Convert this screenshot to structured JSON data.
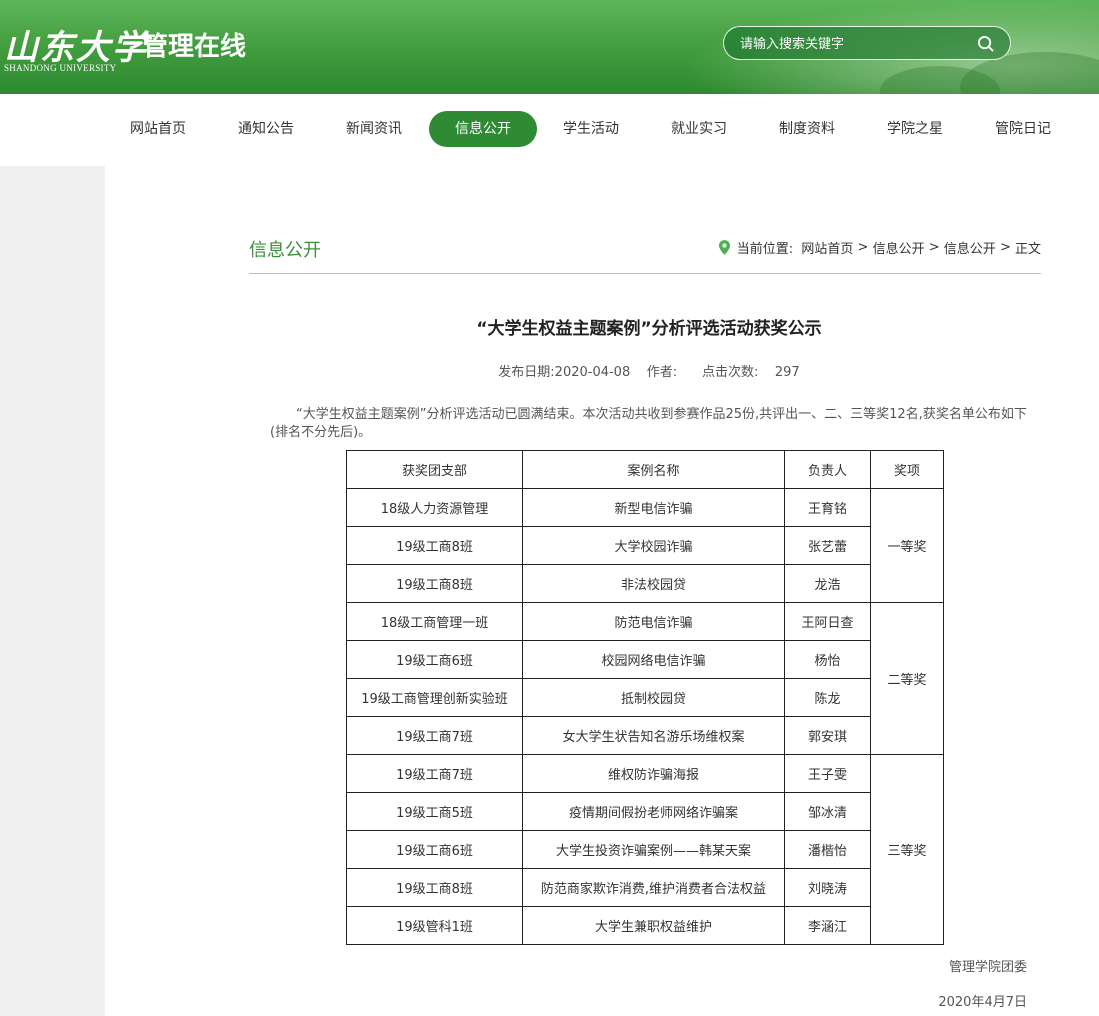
{
  "header": {
    "logo_cn": "山东大学",
    "logo_en": "SHANDONG UNIVERSITY",
    "site_title": "管理在线",
    "search_placeholder": "请输入搜索关键字",
    "search_icon": "search-icon"
  },
  "nav": {
    "items": [
      "网站首页",
      "通知公告",
      "新闻资讯",
      "信息公开",
      "学生活动",
      "就业实习",
      "制度资料",
      "学院之星",
      "管院日记"
    ],
    "active": "信息公开"
  },
  "section": {
    "title": "信息公开",
    "breadcrumb_label": "当前位置:",
    "breadcrumb": [
      "网站首页",
      "信息公开",
      "信息公开",
      "正文"
    ],
    "separator": ">"
  },
  "article": {
    "title": "“大学生权益主题案例”分析评选活动获奖公示",
    "publish_label": "发布日期:",
    "publish_date": "2020-04-08",
    "author_label": "作者:",
    "views_label": "点击次数:",
    "views": "297",
    "intro": "“大学生权益主题案例”分析评选活动已圆满结束。本次活动共收到参赛作品25份,共评出一、二、三等奖12名,获奖名单公布如下(排名不分先后)。",
    "signature": "管理学院团委",
    "sign_date": "2020年4月7日"
  },
  "table": {
    "headers": [
      "获奖团支部",
      "案例名称",
      "负责人",
      "奖项"
    ],
    "groups": [
      {
        "award": "一等奖",
        "rows": [
          [
            "18级人力资源管理",
            "新型电信诈骗",
            "王育铭"
          ],
          [
            "19级工商8班",
            "大学校园诈骗",
            "张艺蕾"
          ],
          [
            "19级工商8班",
            "非法校园贷",
            "龙浩"
          ]
        ]
      },
      {
        "award": "二等奖",
        "rows": [
          [
            "18级工商管理一班",
            "防范电信诈骗",
            "王阿日查"
          ],
          [
            "19级工商6班",
            "校园网络电信诈骗",
            "杨怡"
          ],
          [
            "19级工商管理创新实验班",
            "抵制校园贷",
            "陈龙"
          ],
          [
            "19级工商7班",
            "女大学生状告知名游乐场维权案",
            "郭安琪"
          ]
        ]
      },
      {
        "award": "三等奖",
        "rows": [
          [
            "19级工商7班",
            "维权防诈骗海报",
            "王子雯"
          ],
          [
            "19级工商5班",
            "疫情期间假扮老师网络诈骗案",
            "邹冰清"
          ],
          [
            "19级工商6班",
            "大学生投资诈骗案例——韩某天案",
            "潘楷怡"
          ],
          [
            "19级工商8班",
            "防范商家欺诈消费,维护消费者合法权益",
            "刘晓涛"
          ],
          [
            "19级管科1班",
            "大学生兼职权益维护",
            "李涵江"
          ]
        ]
      }
    ]
  },
  "colors": {
    "brand_green": "#2e8b34",
    "section_title": "#3a8f3a"
  }
}
